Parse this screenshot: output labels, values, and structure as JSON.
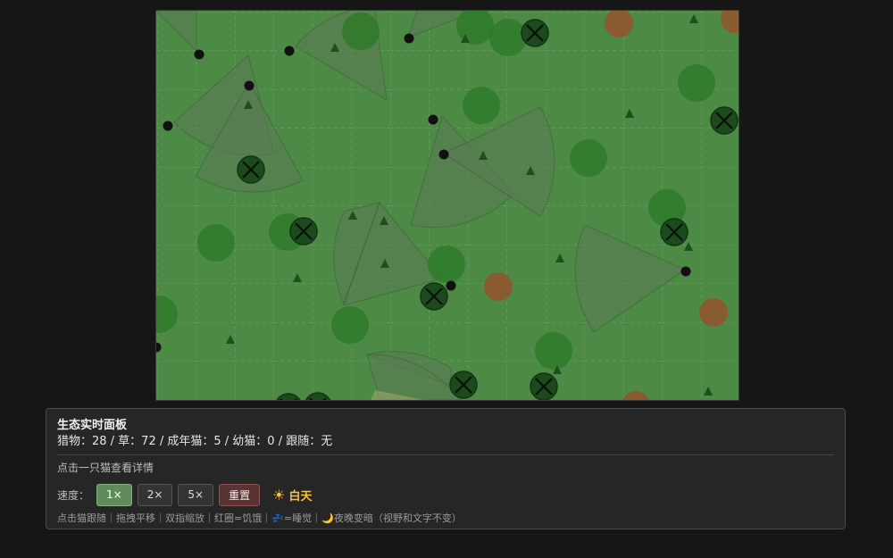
{
  "colors": {
    "grass_bg": "#4c8a45",
    "bush": "#2f7a2b",
    "dead_bush": "#8a5a30",
    "cat": "#1a3f1a",
    "prey": "#111111",
    "active_btn": "#5f8a5b",
    "reset_btn": "#5a3333",
    "day_text": "#f6c343"
  },
  "panel": {
    "title": "生态实时面板",
    "stats": "猎物：28 / 草：72 / 成年猫：5 / 幼猫：0 / 跟随：无",
    "hint": "点击一只猫查看详情",
    "speed_label": "速度：",
    "speed_options": [
      "1×",
      "2×",
      "5×"
    ],
    "selected_speed": "1×",
    "reset_label": "重置",
    "day_icon": "sun-icon",
    "day_label": "白天",
    "legend": "点击猫跟随｜拖拽平移｜双指缩放｜红圈=饥饿｜💤=睡觉｜🌙夜晚变暗（视野和文字不变）"
  },
  "world": {
    "entity_counts": {
      "cats_visible": 12,
      "prey_visible": 13,
      "bushes_visible": 17
    }
  }
}
